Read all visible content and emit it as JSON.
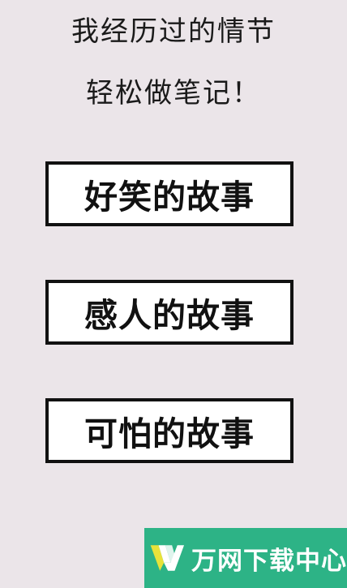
{
  "header": {
    "line1": "我经历过的情节",
    "line2": "轻松做笔记！"
  },
  "buttons": [
    {
      "label": "好笑的故事"
    },
    {
      "label": "感人的故事"
    },
    {
      "label": "可怕的故事"
    }
  ],
  "watermark": {
    "text": "万网下载中心",
    "logo_icon": "wanwang-logo-icon",
    "background_color": "#2db386"
  },
  "colors": {
    "background": "#ebe5e9",
    "button_border": "#111111",
    "button_fill": "#ffffff"
  }
}
